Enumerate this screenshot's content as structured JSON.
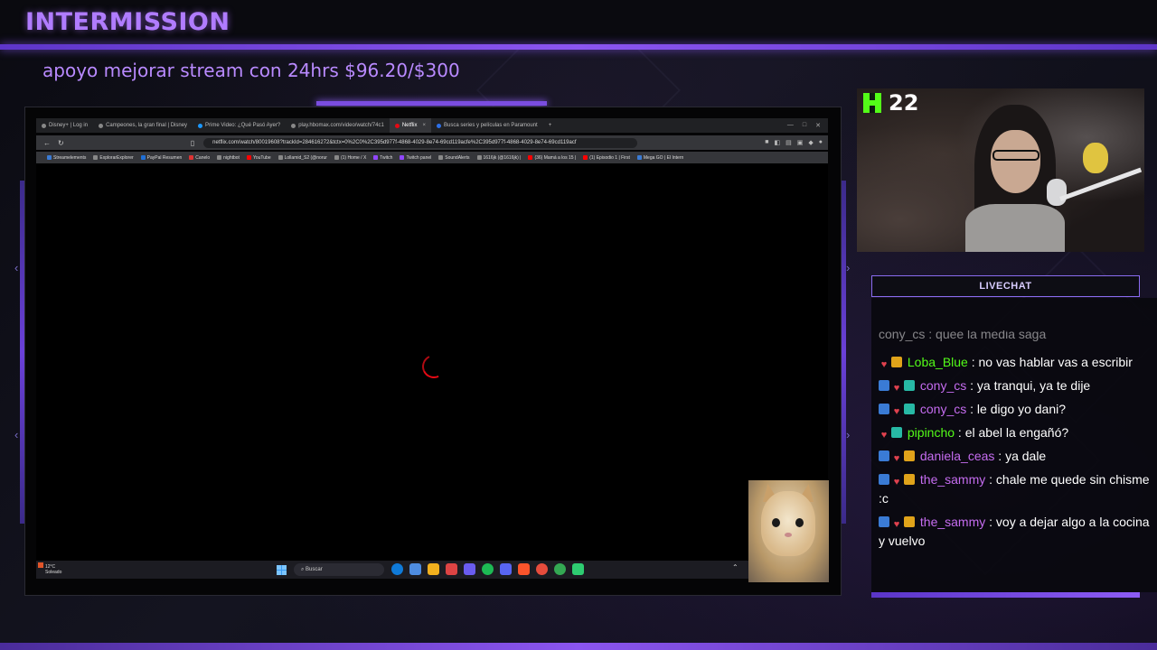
{
  "stream": {
    "title": "INTERMISSION",
    "support_text": "apoyo mejorar stream con 24hrs $96.20/$300",
    "viewer_count": "22"
  },
  "browser": {
    "tabs": [
      {
        "label": "Disney+ | Log in",
        "active": false
      },
      {
        "label": "Campeones, la gran final | Disney",
        "active": false
      },
      {
        "label": "Prime Video: ¿Qué Pasó Ayer?",
        "active": false
      },
      {
        "label": "play.hbomax.com/video/watch/74c1",
        "active": false
      },
      {
        "label": "Netflix",
        "active": true
      },
      {
        "label": "Busca series y películas en Paramount",
        "active": false
      }
    ],
    "url": "netflix.com/watch/80019608?trackId=284616272&tctx=0%2C0%2C395d977f-4868-4029-8e74-69cd119acfe%2C395d977f-4868-4029-8e74-69cd119acf",
    "bookmarks": [
      "Streamelements",
      "ExplorarExplorer",
      "PayPal Resumen",
      "Canelo",
      "nightbot",
      "YouTube",
      "Lollamid_S2 (@norur",
      "(1) Home / X",
      "Twitch",
      "Twitch panel",
      "SoundAlerts",
      "1616jk (@1616jk) |",
      "(36) Mamá a los 15 |",
      "(1) Episodio 1 | First",
      "Mega GO | El Intern"
    ]
  },
  "taskbar": {
    "weather_temp": "12°C",
    "weather_desc": "Soleado",
    "search_placeholder": "Buscar"
  },
  "chat": {
    "header": "LIVECHAT",
    "partial_top": "cony_cs : quee la media saga",
    "messages": [
      {
        "user": "Loba_Blue",
        "text": "no vas hablar vas a escribir",
        "user_color": "green",
        "badges": [
          "heart",
          "crown"
        ]
      },
      {
        "user": "cony_cs",
        "text": "ya tranqui, ya te dije",
        "user_color": "purple",
        "badges": [
          "share",
          "heart",
          "cube"
        ]
      },
      {
        "user": "cony_cs",
        "text": "le digo yo dani?",
        "user_color": "purple",
        "badges": [
          "share",
          "heart",
          "cube"
        ]
      },
      {
        "user": "pipincho",
        "text": "el abel la engañó?",
        "user_color": "green",
        "badges": [
          "heart",
          "cube"
        ]
      },
      {
        "user": "daniela_ceas",
        "text": "ya dale",
        "user_color": "purple",
        "badges": [
          "share",
          "heart",
          "crown"
        ]
      },
      {
        "user": "the_sammy",
        "text": "chale me quede sin chisme :c",
        "user_color": "purple",
        "badges": [
          "share",
          "heart",
          "crown"
        ]
      },
      {
        "user": "the_sammy",
        "text": "voy a dejar algo a la cocina y vuelvo",
        "user_color": "purple",
        "badges": [
          "share",
          "heart",
          "crown"
        ]
      }
    ]
  },
  "colors": {
    "accent_purple": "#8b55f0",
    "kick_green": "#53fc18",
    "netflix_red": "#e50914"
  }
}
